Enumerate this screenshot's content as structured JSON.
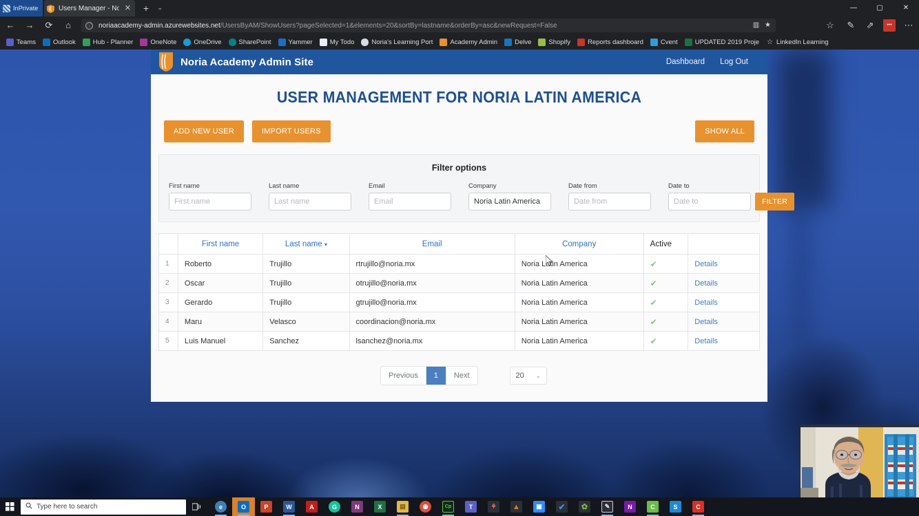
{
  "browser": {
    "inprivate_label": "InPrivate",
    "tab": {
      "title": "Users Manager - Noria .",
      "close": "✕",
      "favicon": "shield-icon"
    },
    "new_tab": "+",
    "tab_menu": "⌄",
    "nav": {
      "back": "←",
      "forward": "→",
      "reload": "⟳",
      "home": "⌂"
    },
    "url": {
      "host": "noriaacademy-admin.azurewebsites.net",
      "path": "/UsersByAM/ShowUsers?pageSelected=1&elements=20&sortBy=lastname&orderBy=asc&newRequest=False",
      "info_icon": "ⓘ"
    },
    "url_actions": [
      {
        "name": "reading-view-icon",
        "glyph": "▥"
      },
      {
        "name": "favorite-star-icon",
        "glyph": "★"
      }
    ],
    "toolbar_actions": [
      {
        "name": "add-favorite-icon",
        "glyph": "☆"
      },
      {
        "name": "collections-icon",
        "glyph": "✎"
      },
      {
        "name": "share-icon",
        "glyph": "⇗"
      },
      {
        "name": "extension-badge-icon",
        "glyph": "•••"
      },
      {
        "name": "settings-more-icon",
        "glyph": "⋯"
      }
    ],
    "window_controls": [
      {
        "name": "minimize-button",
        "glyph": "—"
      },
      {
        "name": "maximize-button",
        "glyph": "▢"
      },
      {
        "name": "close-button",
        "glyph": "✕"
      }
    ],
    "bookmarks": [
      {
        "label": "Teams",
        "color": "#5b5fc7"
      },
      {
        "label": "Outlook",
        "color": "#0f6cbd"
      },
      {
        "label": "Hub - Planner",
        "color": "#31a05d"
      },
      {
        "label": "OneNote",
        "color": "#a4379a"
      },
      {
        "label": "OneDrive",
        "color": "#1a9bd7"
      },
      {
        "label": "SharePoint",
        "color": "#038387"
      },
      {
        "label": "Yammer",
        "color": "#1b6ec2"
      },
      {
        "label": "My Todo",
        "color": "#e9edf5"
      },
      {
        "label": "Noria's Learning Port",
        "color": "#d8dde5"
      },
      {
        "label": "Academy Admin",
        "color": "#e8922f"
      },
      {
        "label": "Delve",
        "color": "#1b74bb"
      },
      {
        "label": "Shopify",
        "color": "#95bf47"
      },
      {
        "label": "Reports dashboard",
        "color": "#c8352b"
      },
      {
        "label": "Cvent",
        "color": "#2f9bd8"
      },
      {
        "label": "UPDATED 2019 Proje",
        "color": "#1d7044"
      },
      {
        "label": "LinkedIn Learning",
        "color": "#d9dde4"
      }
    ]
  },
  "site": {
    "brand": "Noria Academy Admin Site",
    "nav": [
      {
        "label": "Dashboard"
      },
      {
        "label": "Log Out"
      }
    ],
    "page_title": "USER MANAGEMENT FOR NORIA LATIN AMERICA",
    "buttons": {
      "add_new_user": "ADD NEW USER",
      "import_users": "IMPORT USERS",
      "show_all": "SHOW ALL"
    },
    "filter": {
      "title": "Filter options",
      "submit": "FILTER",
      "fields": [
        {
          "label": "First name",
          "placeholder": "First name",
          "value": ""
        },
        {
          "label": "Last name",
          "placeholder": "Last name",
          "value": ""
        },
        {
          "label": "Email",
          "placeholder": "Email",
          "value": ""
        },
        {
          "label": "Company",
          "placeholder": "Company",
          "value": "Noria Latin America"
        },
        {
          "label": "Date from",
          "placeholder": "Date from",
          "value": ""
        },
        {
          "label": "Date to",
          "placeholder": "Date to",
          "value": ""
        }
      ]
    },
    "table": {
      "headers": {
        "index": "",
        "first_name": "First name",
        "last_name": "Last name",
        "sort_caret": "▾",
        "email": "Email",
        "company": "Company",
        "active": "Active",
        "details": ""
      },
      "rows": [
        {
          "index": "1",
          "first_name": "Roberto",
          "last_name": "Trujillo",
          "email": "rtrujillo@noria.mx",
          "company": "Noria Latin America",
          "active": "✔",
          "details": "Details"
        },
        {
          "index": "2",
          "first_name": "Oscar",
          "last_name": "Trujillo",
          "email": "otrujillo@noria.mx",
          "company": "Noria Latin America",
          "active": "✔",
          "details": "Details"
        },
        {
          "index": "3",
          "first_name": "Gerardo",
          "last_name": "Trujillo",
          "email": "gtrujillo@noria.mx",
          "company": "Noria Latin America",
          "active": "✔",
          "details": "Details"
        },
        {
          "index": "4",
          "first_name": "Maru",
          "last_name": "Velasco",
          "email": "coordinacion@noria.mx",
          "company": "Noria Latin America",
          "active": "✔",
          "details": "Details"
        },
        {
          "index": "5",
          "first_name": "Luis Manuel",
          "last_name": "Sanchez",
          "email": "lsanchez@noria.mx",
          "company": "Noria Latin America",
          "active": "✔",
          "details": "Details"
        }
      ]
    },
    "pagination": {
      "previous": "Previous",
      "current_page": "1",
      "next": "Next",
      "page_size": "20",
      "caret": "⌄"
    },
    "colors": {
      "header_blue": "#20569e",
      "title_blue": "#1d4f91",
      "accent_orange": "#e8922f",
      "link_blue": "#2f70c4",
      "active_green": "#7fc97f"
    }
  },
  "taskbar": {
    "start": "⊞",
    "search_icon": "🔍",
    "search_placeholder": "Type here to search",
    "task_view": "❑",
    "apps": [
      {
        "name": "edge",
        "glyph": "e",
        "color": "#3d7fb8",
        "running": true,
        "active": false
      },
      {
        "name": "outlook",
        "glyph": "O",
        "color": "#0f6cbd",
        "running": true,
        "active": true
      },
      {
        "name": "powerpoint",
        "glyph": "P",
        "color": "#c8432b",
        "running": false,
        "active": false
      },
      {
        "name": "word",
        "glyph": "W",
        "color": "#2b579a",
        "running": true,
        "active": false
      },
      {
        "name": "acrobat",
        "glyph": "A",
        "color": "#c31e1e",
        "running": false,
        "active": false
      },
      {
        "name": "grammarly",
        "glyph": "G",
        "color": "#15c39a",
        "running": false,
        "active": false
      },
      {
        "name": "onenote",
        "glyph": "N",
        "color": "#80397b",
        "running": false,
        "active": false
      },
      {
        "name": "excel",
        "glyph": "X",
        "color": "#1e7145",
        "running": false,
        "active": false
      },
      {
        "name": "explorer",
        "glyph": "▤",
        "color": "#e0b94a",
        "running": true,
        "active": false
      },
      {
        "name": "chrome",
        "glyph": "◉",
        "color": "#d94f3d",
        "running": false,
        "active": false
      },
      {
        "name": "captivate",
        "glyph": "Cp",
        "color": "#1a8a4a",
        "running": true,
        "active": false
      },
      {
        "name": "teams",
        "glyph": "T",
        "color": "#5b5fc7",
        "running": false,
        "active": false
      },
      {
        "name": "hubspot",
        "glyph": "⚘",
        "color": "#f2765c",
        "running": false,
        "active": false
      },
      {
        "name": "vlc",
        "glyph": "▲",
        "color": "#e07820",
        "running": false,
        "active": false
      },
      {
        "name": "zoom",
        "glyph": "▣",
        "color": "#2d8cff",
        "running": false,
        "active": false
      },
      {
        "name": "check-app",
        "glyph": "✔",
        "color": "#3b8fe0",
        "running": false,
        "active": false
      },
      {
        "name": "paint",
        "glyph": "✿",
        "color": "#7ab648",
        "running": false,
        "active": false
      },
      {
        "name": "snip",
        "glyph": "✎",
        "color": "#3f4350",
        "running": true,
        "active": false
      },
      {
        "name": "onenote-2",
        "glyph": "N",
        "color": "#7719aa",
        "running": false,
        "active": false
      },
      {
        "name": "camtasia",
        "glyph": "C",
        "color": "#6cbe45",
        "running": true,
        "active": false
      },
      {
        "name": "skype",
        "glyph": "S",
        "color": "#1e88d4",
        "running": false,
        "active": false
      },
      {
        "name": "camtasia-2",
        "glyph": "C",
        "color": "#d93025",
        "running": true,
        "active": false
      }
    ]
  }
}
